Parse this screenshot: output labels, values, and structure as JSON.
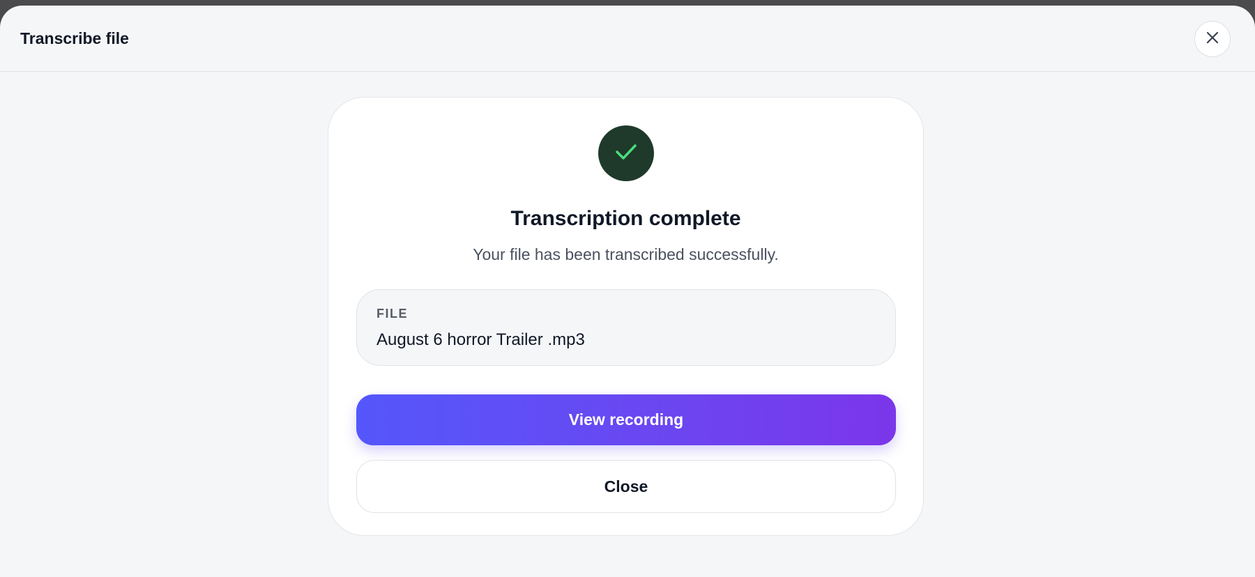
{
  "header": {
    "title": "Transcribe file",
    "close_icon": "close-icon"
  },
  "card": {
    "status_icon": "check-icon",
    "status_color": "#4ade80",
    "status_bg": "#1f3a2a",
    "title": "Transcription complete",
    "subtitle": "Your file has been transcribed successfully.",
    "file": {
      "label": "FILE",
      "name": "August 6 horror Trailer .mp3"
    },
    "primary_button": "View recording",
    "secondary_button": "Close"
  },
  "colors": {
    "accent_start": "#5457fb",
    "accent_end": "#7b36ea"
  }
}
